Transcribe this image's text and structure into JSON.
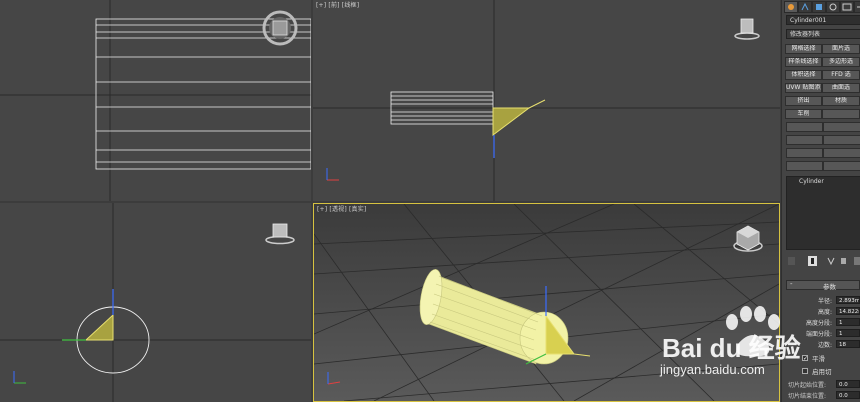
{
  "viewports": {
    "top_left": {
      "label": ""
    },
    "top_right": {
      "label": "[+] [前] [线框]"
    },
    "bottom_left": {
      "label": ""
    },
    "bottom_right": {
      "label": "[+] [透视] [真实]"
    }
  },
  "panel": {
    "object_name": "Cylinder001",
    "modifier_list": "修改器列表",
    "modifier_buttons": [
      {
        "left": "网格选择",
        "right": "面片选"
      },
      {
        "left": "样条线选择",
        "right": "多边形选"
      },
      {
        "left": "体积选择",
        "right": "FFD 选"
      },
      {
        "left": "UVW 贴图添加",
        "right": "曲面选"
      },
      {
        "left": "挤出",
        "right": "材质"
      },
      {
        "left": "车削",
        "right": ""
      }
    ],
    "stack_item": "Cylinder",
    "rollout_title": "参数",
    "params": [
      {
        "label": "半径:",
        "value": "2.893m"
      },
      {
        "label": "高度:",
        "value": "14.822m"
      },
      {
        "label": "高度分段:",
        "value": "1"
      },
      {
        "label": "端面分段:",
        "value": "1"
      },
      {
        "label": "边数:",
        "value": "18"
      }
    ],
    "smooth_label": "平滑",
    "slice_label": "启用切",
    "slice_from": "切片起始位置:",
    "slice_to": "切片结束位置:",
    "slice_from_value": "0.0",
    "slice_to_value": "0.0"
  },
  "watermark": {
    "brand": "Bai du 经验",
    "url": "jingyan.baidu.com"
  },
  "colors": {
    "viewport_bg": "#464646",
    "active_border": "#d6c240",
    "cylinder": "#f2f2a6",
    "gizmo_yellow": "#e8e070"
  }
}
